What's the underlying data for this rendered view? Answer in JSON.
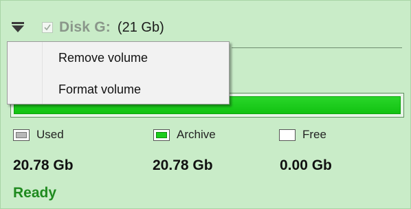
{
  "volume": {
    "name": "Disk G:",
    "size": "(21 Gb)",
    "checked": true
  },
  "context_menu": {
    "items": [
      {
        "label": "Remove volume"
      },
      {
        "label": "Format volume"
      }
    ]
  },
  "usage_bar": {
    "used_fraction": 1.0,
    "fill_color": "#1ccc1c"
  },
  "legend": {
    "used_label": "Used",
    "archive_label": "Archive",
    "free_label": "Free",
    "used_color": "#b8b8b8",
    "archive_color": "#1ccc1c",
    "free_color": "#ffffff"
  },
  "values": {
    "used": "20.78 Gb",
    "archive": "20.78 Gb",
    "free": "0.00 Gb"
  },
  "status": "Ready",
  "colors": {
    "panel_background": "#c9ecc8",
    "status_text": "#1f8a1f"
  },
  "icons": {
    "menu": "dropdown-menu-icon",
    "checkbox": "checkmark-icon"
  }
}
